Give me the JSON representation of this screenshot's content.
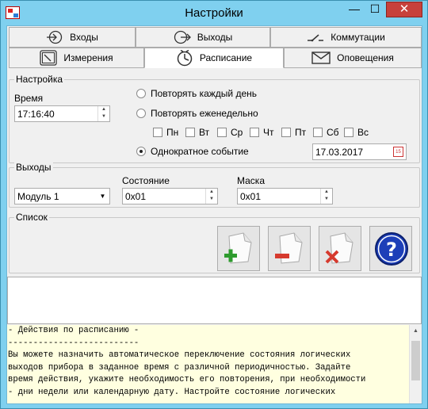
{
  "window": {
    "title": "Настройки",
    "close_glyph": "✕",
    "min_glyph": "—",
    "max_glyph": "☐",
    "colors": {
      "chrome": "#7fd0ef",
      "close": "#c7413b",
      "info_bg": "#ffffe0"
    }
  },
  "tabs": {
    "row1": [
      {
        "label": "Входы",
        "icon": "login-arrow-icon"
      },
      {
        "label": "Выходы",
        "icon": "logout-arrow-icon"
      },
      {
        "label": "Коммутации",
        "icon": "switch-icon"
      }
    ],
    "row2": [
      {
        "label": "Измерения",
        "icon": "meter-icon"
      },
      {
        "label": "Расписание",
        "icon": "clock-icon",
        "active": true
      },
      {
        "label": "Оповещения",
        "icon": "envelope-icon"
      }
    ]
  },
  "settings": {
    "group_title": "Настройка",
    "time_label": "Время",
    "time_value": "17:16:40",
    "repeat_daily": "Повторять каждый день",
    "repeat_weekly": "Повторять еженедельно",
    "days": [
      "Пн",
      "Вт",
      "Ср",
      "Чт",
      "Пт",
      "Сб",
      "Вс"
    ],
    "one_time": "Однократное событие",
    "date_value": "17.03.2017",
    "calendar_glyph": "15",
    "selected_mode": "one_time"
  },
  "outputs": {
    "group_title": "Выходы",
    "module_value": "Модуль 1",
    "state_label": "Состояние",
    "state_value": "0x01",
    "mask_label": "Маска",
    "mask_value": "0x01"
  },
  "list": {
    "group_title": "Список",
    "buttons": [
      "add-button",
      "remove-button",
      "delete-button",
      "help-button"
    ]
  },
  "info": {
    "lines": [
      "- Действия по расписанию -",
      "--------------------------",
      "Вы можете назначить автоматическое переключение состояния логических",
      "выходов прибора в заданное время с различной периодичностью. Задайте",
      "время действия, укажите необходимость его повторения, при необходимости",
      "- дни недели или календарную дату. Настройте состояние логических"
    ]
  }
}
